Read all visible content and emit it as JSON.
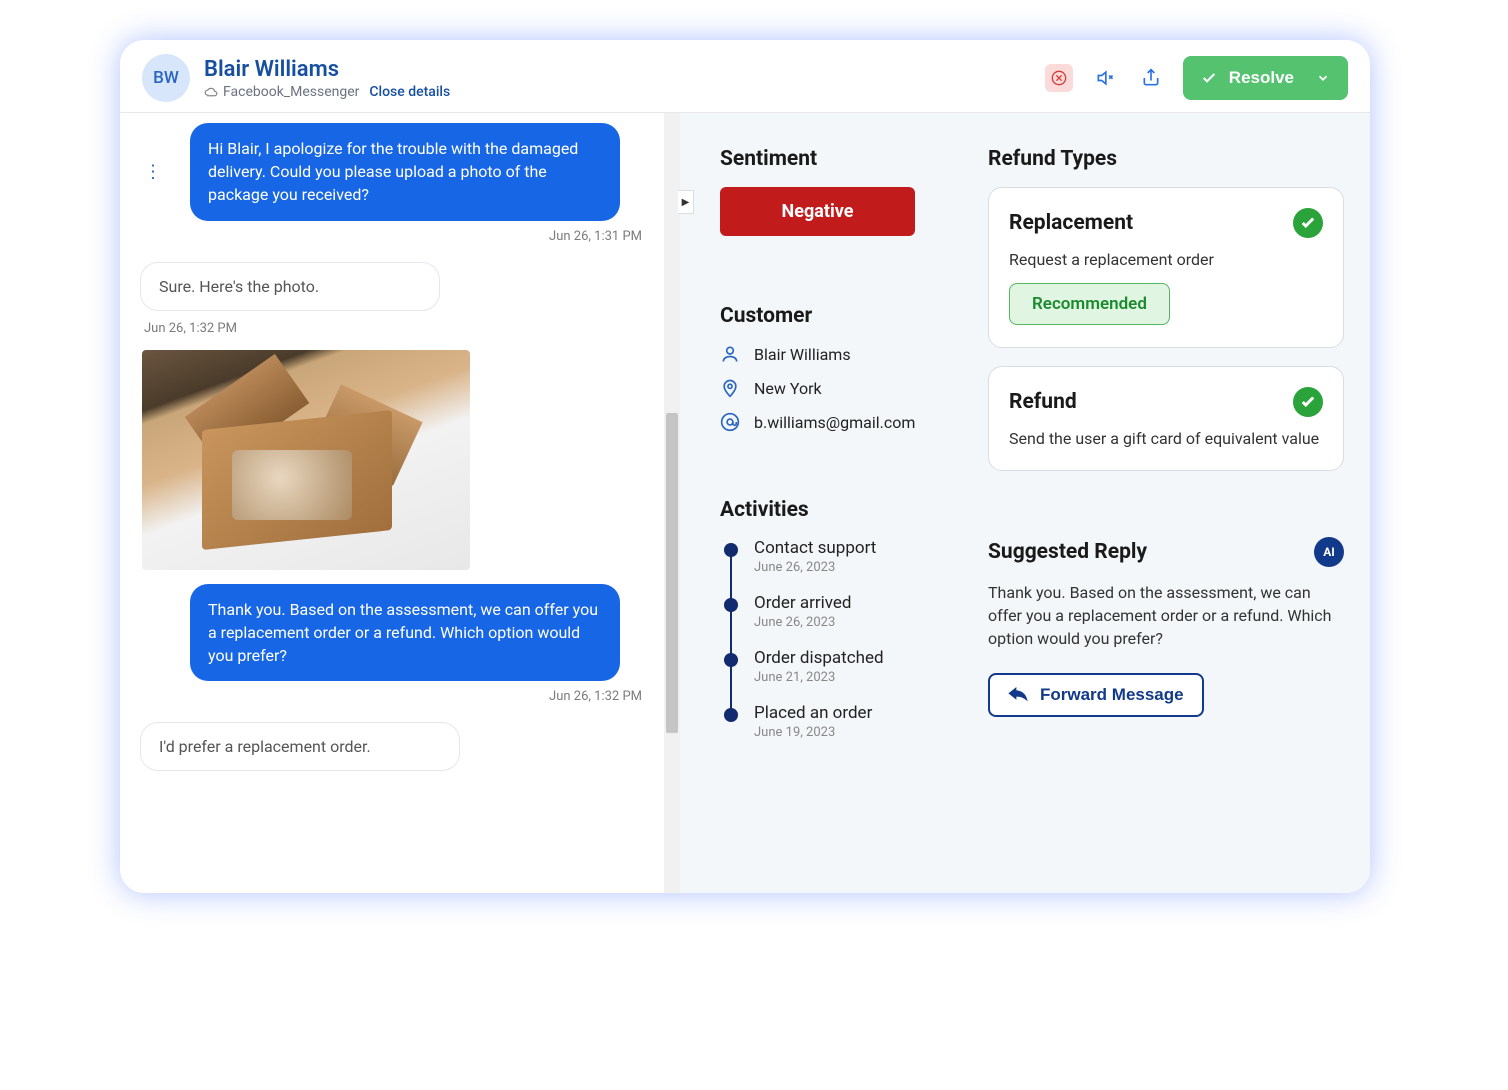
{
  "header": {
    "initials": "BW",
    "name": "Blair Williams",
    "channel": "Facebook_Messenger",
    "close_label": "Close details",
    "resolve_label": "Resolve"
  },
  "chat": {
    "msg1": "Hi Blair, I apologize for the trouble with the damaged delivery. Could you please upload a photo of the package you received?",
    "ts1": "Jun 26, 1:31 PM",
    "msg2": "Sure. Here's the photo.",
    "ts2": "Jun 26, 1:32 PM",
    "msg3": "Thank you. Based on the assessment, we can offer you a replacement order or a refund. Which option would you prefer?",
    "ts3": "Jun 26, 1:32 PM",
    "msg4": "I'd prefer a replacement order."
  },
  "sentiment": {
    "title": "Sentiment",
    "value": "Negative"
  },
  "customer": {
    "title": "Customer",
    "name": "Blair Williams",
    "location": "New York",
    "email": "b.williams@gmail.com"
  },
  "activities": {
    "title": "Activities",
    "items": [
      {
        "title": "Contact support",
        "date": "June 26, 2023"
      },
      {
        "title": "Order arrived",
        "date": "June 26, 2023"
      },
      {
        "title": "Order dispatched",
        "date": "June 21, 2023"
      },
      {
        "title": "Placed an order",
        "date": "June 19, 2023"
      }
    ]
  },
  "refund": {
    "title": "Refund Types",
    "cards": [
      {
        "title": "Replacement",
        "desc": "Request a replacement order",
        "recommended": "Recommended"
      },
      {
        "title": "Refund",
        "desc": "Send the user a gift card of equivalent value"
      }
    ]
  },
  "suggested": {
    "title": "Suggested Reply",
    "ai_label": "AI",
    "text": "Thank you. Based on the assessment, we can offer you a replacement order or a refund. Which option would you prefer?",
    "forward_label": "Forward Message"
  }
}
